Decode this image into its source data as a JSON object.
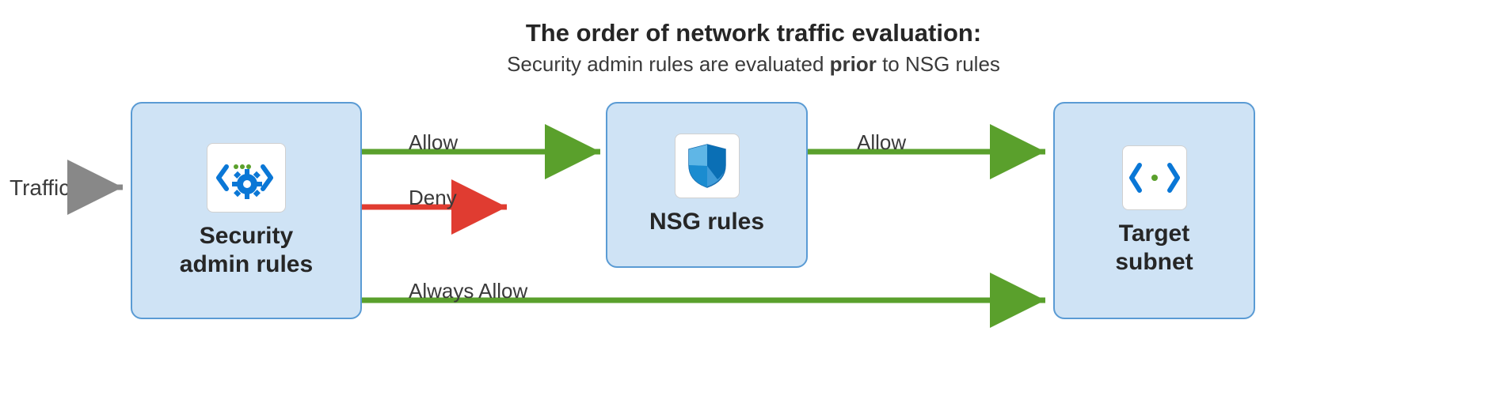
{
  "header": {
    "title": "The order of network traffic evaluation:",
    "subtitle_before": "Security admin rules are evaluated ",
    "subtitle_bold": "prior",
    "subtitle_after": " to NSG rules"
  },
  "nodes": {
    "traffic_label": "Traffic",
    "security_admin": "Security\nadmin rules",
    "nsg": "NSG rules",
    "target": "Target\nsubnet"
  },
  "arrows": {
    "allow1": "Allow",
    "deny": "Deny",
    "always_allow": "Always Allow",
    "allow2": "Allow"
  },
  "colors": {
    "green": "#5aa02c",
    "red": "#e03c31",
    "gray": "#888888",
    "box_fill": "#cfe3f5",
    "box_border": "#5a9bd4"
  }
}
